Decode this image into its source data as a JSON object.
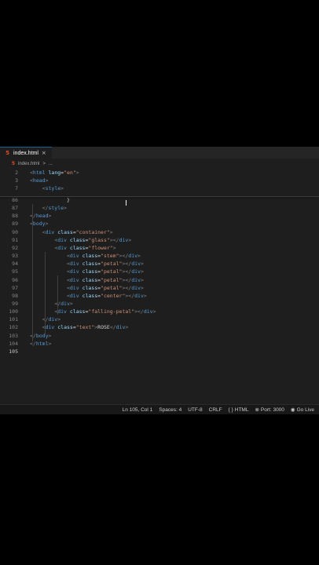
{
  "tab": {
    "filename": "index.html",
    "close_glyph": "×"
  },
  "breadcrumb": {
    "file": "index.html",
    "separator": ">",
    "more": "..."
  },
  "editor": {
    "active_line": "105",
    "lines": [
      {
        "num": "2",
        "tokens": [
          [
            "br",
            "<"
          ],
          [
            "tag",
            "html"
          ],
          [
            "txt",
            " "
          ],
          [
            "attr",
            "lang"
          ],
          [
            "txt",
            "="
          ],
          [
            "str",
            "\"en\""
          ],
          [
            "br",
            ">"
          ]
        ]
      },
      {
        "num": "3",
        "tokens": [
          [
            "br",
            "<"
          ],
          [
            "tag",
            "head"
          ],
          [
            "br",
            ">"
          ]
        ]
      },
      {
        "num": "7",
        "tokens": [
          [
            "txt",
            "    "
          ],
          [
            "br",
            "<"
          ],
          [
            "tag",
            "style"
          ],
          [
            "br",
            ">"
          ]
        ]
      },
      {
        "num": "86",
        "tokens": [
          [
            "txt",
            "            }"
          ]
        ]
      },
      {
        "num": "87",
        "tokens": [
          [
            "txt",
            "    "
          ],
          [
            "br",
            "</"
          ],
          [
            "tag",
            "style"
          ],
          [
            "br",
            ">"
          ]
        ]
      },
      {
        "num": "88",
        "tokens": [
          [
            "br",
            "</"
          ],
          [
            "tag",
            "head"
          ],
          [
            "br",
            ">"
          ]
        ]
      },
      {
        "num": "89",
        "tokens": [
          [
            "br",
            "<"
          ],
          [
            "tag",
            "body"
          ],
          [
            "br",
            ">"
          ]
        ]
      },
      {
        "num": "90",
        "tokens": [
          [
            "txt",
            "    "
          ],
          [
            "br",
            "<"
          ],
          [
            "tag",
            "div"
          ],
          [
            "txt",
            " "
          ],
          [
            "attr",
            "class"
          ],
          [
            "txt",
            "="
          ],
          [
            "str",
            "\"container\""
          ],
          [
            "br",
            ">"
          ]
        ]
      },
      {
        "num": "91",
        "tokens": [
          [
            "txt",
            "        "
          ],
          [
            "br",
            "<"
          ],
          [
            "tag",
            "div"
          ],
          [
            "txt",
            " "
          ],
          [
            "attr",
            "class"
          ],
          [
            "txt",
            "="
          ],
          [
            "str",
            "\"glass\""
          ],
          [
            "br",
            "></"
          ],
          [
            "tag",
            "div"
          ],
          [
            "br",
            ">"
          ]
        ]
      },
      {
        "num": "92",
        "tokens": [
          [
            "txt",
            "        "
          ],
          [
            "br",
            "<"
          ],
          [
            "tag",
            "div"
          ],
          [
            "txt",
            " "
          ],
          [
            "attr",
            "class"
          ],
          [
            "txt",
            "="
          ],
          [
            "str",
            "\"flower\""
          ],
          [
            "br",
            ">"
          ]
        ]
      },
      {
        "num": "93",
        "tokens": [
          [
            "txt",
            "            "
          ],
          [
            "br",
            "<"
          ],
          [
            "tag",
            "div"
          ],
          [
            "txt",
            " "
          ],
          [
            "attr",
            "class"
          ],
          [
            "txt",
            "="
          ],
          [
            "str",
            "\"stem\""
          ],
          [
            "br",
            "></"
          ],
          [
            "tag",
            "div"
          ],
          [
            "br",
            ">"
          ]
        ]
      },
      {
        "num": "94",
        "tokens": [
          [
            "txt",
            "            "
          ],
          [
            "br",
            "<"
          ],
          [
            "tag",
            "div"
          ],
          [
            "txt",
            " "
          ],
          [
            "attr",
            "class"
          ],
          [
            "txt",
            "="
          ],
          [
            "str",
            "\"petal\""
          ],
          [
            "br",
            "></"
          ],
          [
            "tag",
            "div"
          ],
          [
            "br",
            ">"
          ]
        ]
      },
      {
        "num": "95",
        "tokens": [
          [
            "txt",
            "            "
          ],
          [
            "br",
            "<"
          ],
          [
            "tag",
            "div"
          ],
          [
            "txt",
            " "
          ],
          [
            "attr",
            "class"
          ],
          [
            "txt",
            "="
          ],
          [
            "str",
            "\"petal\""
          ],
          [
            "br",
            "></"
          ],
          [
            "tag",
            "div"
          ],
          [
            "br",
            ">"
          ]
        ]
      },
      {
        "num": "96",
        "tokens": [
          [
            "txt",
            "            "
          ],
          [
            "br",
            "<"
          ],
          [
            "tag",
            "div"
          ],
          [
            "txt",
            " "
          ],
          [
            "attr",
            "class"
          ],
          [
            "txt",
            "="
          ],
          [
            "str",
            "\"petal\""
          ],
          [
            "br",
            "></"
          ],
          [
            "tag",
            "div"
          ],
          [
            "br",
            ">"
          ]
        ]
      },
      {
        "num": "97",
        "tokens": [
          [
            "txt",
            "            "
          ],
          [
            "br",
            "<"
          ],
          [
            "tag",
            "div"
          ],
          [
            "txt",
            " "
          ],
          [
            "attr",
            "class"
          ],
          [
            "txt",
            "="
          ],
          [
            "str",
            "\"petal\""
          ],
          [
            "br",
            "></"
          ],
          [
            "tag",
            "div"
          ],
          [
            "br",
            ">"
          ]
        ]
      },
      {
        "num": "98",
        "tokens": [
          [
            "txt",
            "            "
          ],
          [
            "br",
            "<"
          ],
          [
            "tag",
            "div"
          ],
          [
            "txt",
            " "
          ],
          [
            "attr",
            "class"
          ],
          [
            "txt",
            "="
          ],
          [
            "str",
            "\"center\""
          ],
          [
            "br",
            "></"
          ],
          [
            "tag",
            "div"
          ],
          [
            "br",
            ">"
          ]
        ]
      },
      {
        "num": "99",
        "tokens": [
          [
            "txt",
            "        "
          ],
          [
            "br",
            "</"
          ],
          [
            "tag",
            "div"
          ],
          [
            "br",
            ">"
          ]
        ]
      },
      {
        "num": "100",
        "tokens": [
          [
            "txt",
            "        "
          ],
          [
            "br",
            "<"
          ],
          [
            "tag",
            "div"
          ],
          [
            "txt",
            " "
          ],
          [
            "attr",
            "class"
          ],
          [
            "txt",
            "="
          ],
          [
            "str",
            "\"falling-petal\""
          ],
          [
            "br",
            "></"
          ],
          [
            "tag",
            "div"
          ],
          [
            "br",
            ">"
          ]
        ]
      },
      {
        "num": "101",
        "tokens": [
          [
            "txt",
            "    "
          ],
          [
            "br",
            "</"
          ],
          [
            "tag",
            "div"
          ],
          [
            "br",
            ">"
          ]
        ]
      },
      {
        "num": "102",
        "tokens": [
          [
            "txt",
            "    "
          ],
          [
            "br",
            "<"
          ],
          [
            "tag",
            "div"
          ],
          [
            "txt",
            " "
          ],
          [
            "attr",
            "class"
          ],
          [
            "txt",
            "="
          ],
          [
            "str",
            "\"text\""
          ],
          [
            "br",
            ">"
          ],
          [
            "txt",
            "ROSE"
          ],
          [
            "br",
            "</"
          ],
          [
            "tag",
            "div"
          ],
          [
            "br",
            ">"
          ]
        ]
      },
      {
        "num": "103",
        "tokens": [
          [
            "br",
            "</"
          ],
          [
            "tag",
            "body"
          ],
          [
            "br",
            ">"
          ]
        ]
      },
      {
        "num": "104",
        "tokens": [
          [
            "br",
            "</"
          ],
          [
            "tag",
            "html"
          ],
          [
            "br",
            ">"
          ]
        ]
      },
      {
        "num": "105",
        "tokens": []
      }
    ]
  },
  "statusbar": {
    "position": "Ln 105, Col 1",
    "spaces": "Spaces: 4",
    "encoding": "UTF-8",
    "eol": "CRLF",
    "language": "HTML",
    "language_icon": "{ }",
    "port": "Port: 3000",
    "go_live": "Go Live"
  },
  "colors": {
    "editor_bg": "#1e1e1e",
    "tag": "#569cd6",
    "attr": "#9cdcfe",
    "string": "#ce9178",
    "punct": "#808080"
  }
}
